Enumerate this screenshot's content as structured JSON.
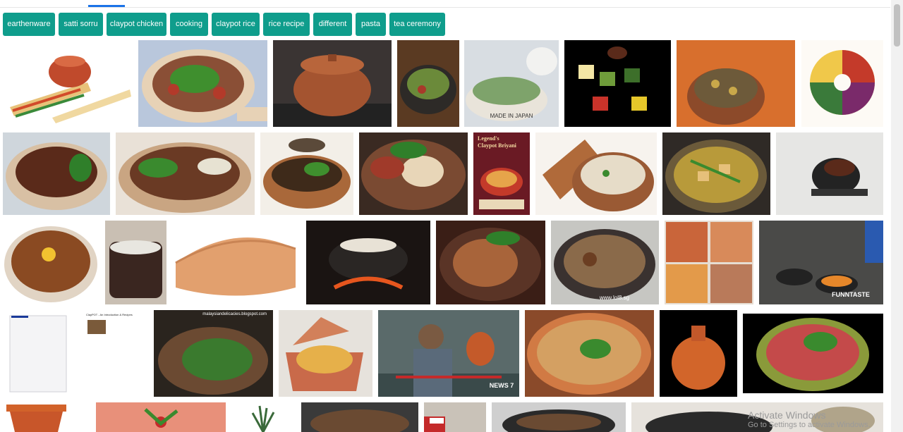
{
  "chips": [
    {
      "label": "earthenware"
    },
    {
      "label": "satti sorru"
    },
    {
      "label": "claypot chicken"
    },
    {
      "label": "cooking"
    },
    {
      "label": "claypot rice"
    },
    {
      "label": "rice recipe"
    },
    {
      "label": "different"
    },
    {
      "label": "pasta"
    },
    {
      "label": "tea ceremony"
    }
  ],
  "overlays": {
    "legend_line1": "Legend's",
    "legend_line2": "Claypot Briyani",
    "made_in_japan": "MADE IN JAPAN",
    "brand_small": "lol8.sg",
    "www_lol8": "www.lol8.sg",
    "funntaste": "FUNNTASTE",
    "malaysian_url": "malaysiandelicacies.blogspot.com",
    "news7": "NEWS 7",
    "document_title": "ClayPOT - An Introduction & Recipes"
  },
  "watermark": {
    "title": "Activate Windows",
    "subtitle": "Go to Settings to activate Windows."
  }
}
